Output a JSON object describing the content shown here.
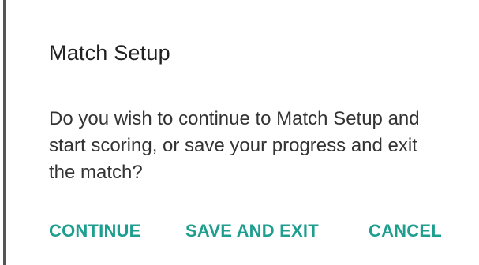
{
  "dialog": {
    "title": "Match Setup",
    "message": "Do you wish to continue to Match Setup and start scoring, or save your progress and exit the match?",
    "actions": {
      "continue_label": "CONTINUE",
      "save_exit_label": "SAVE AND EXIT",
      "cancel_label": "CANCEL"
    }
  },
  "colors": {
    "accent": "#1e9e8e",
    "title_text": "#212121",
    "body_text": "#333333",
    "background": "#ffffff"
  }
}
